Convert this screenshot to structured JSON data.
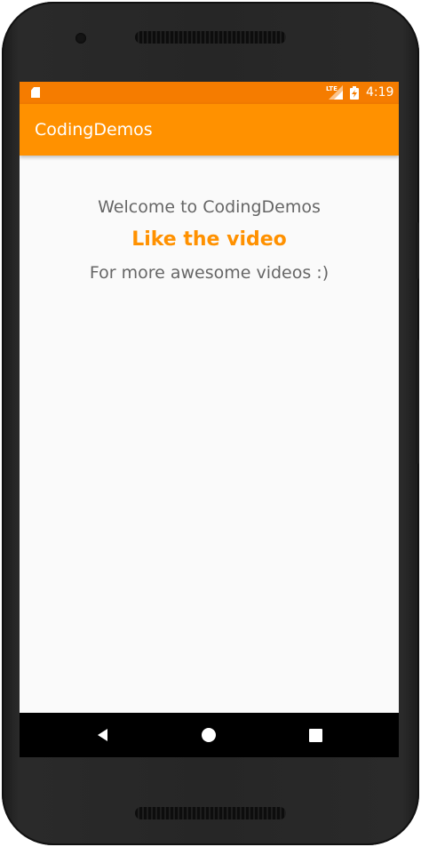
{
  "status_bar": {
    "time": "4:19",
    "network_label": "LTE",
    "icons": [
      "sd-card-icon",
      "lte-signal-icon",
      "battery-charging-icon"
    ]
  },
  "app_bar": {
    "title": "CodingDemos"
  },
  "content": {
    "welcome_text": "Welcome to CodingDemos",
    "like_text": "Like the video",
    "more_text": "For more awesome videos :)"
  },
  "nav_bar": {
    "buttons": [
      "back-icon",
      "home-icon",
      "recents-icon"
    ]
  },
  "colors": {
    "status_bar": "#f57c00",
    "app_bar": "#ff9100",
    "accent_text": "#ff9100",
    "body_text": "#666666",
    "screen_background": "#fafafa",
    "nav_bar": "#000000"
  }
}
